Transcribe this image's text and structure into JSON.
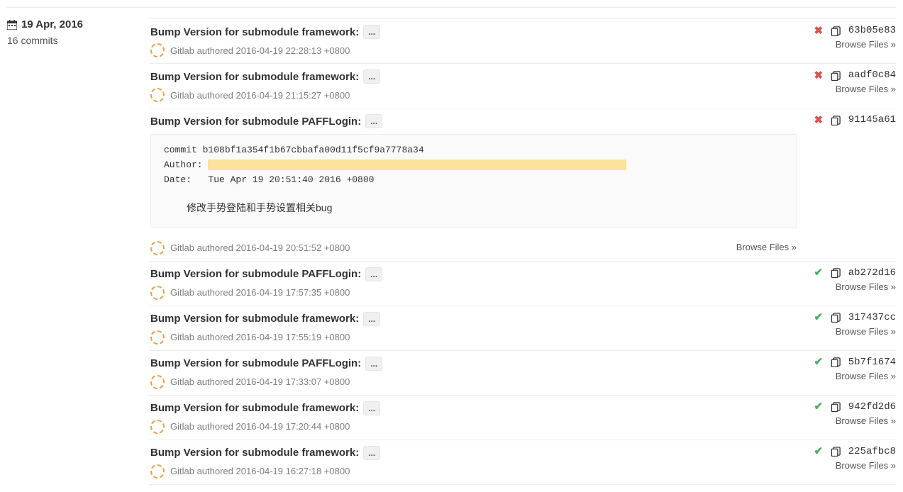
{
  "date": "19 Apr, 2016",
  "commit_count": "16 commits",
  "browse_label": "Browse Files »",
  "commits": [
    {
      "title": "Bump Version for submodule framework:",
      "author": "Gitlab",
      "time": "2016-04-19 22:28:13 +0800",
      "status": "failed",
      "sha": "63b05e83"
    },
    {
      "title": "Bump Version for submodule framework:",
      "author": "Gitlab",
      "time": "2016-04-19 21:15:27 +0800",
      "status": "failed",
      "sha": "aadf0c84"
    },
    {
      "title": "Bump Version for submodule PAFFLogin:",
      "author": "Gitlab",
      "time": "2016-04-19 20:51:52 +0800",
      "status": "failed",
      "sha": "91145a61",
      "expanded": {
        "line1": "commit b108bf1a354f1b67cbbafa00d11f5cf9a7778a34",
        "line2": "Author:",
        "line3": "Date:   Tue Apr 19 20:51:40 2016 +0800",
        "msg": "修改手势登陆和手势设置相关bug"
      }
    },
    {
      "title": "Bump Version for submodule PAFFLogin:",
      "author": "Gitlab",
      "time": "2016-04-19 17:57:35 +0800",
      "status": "success",
      "sha": "ab272d16"
    },
    {
      "title": "Bump Version for submodule framework:",
      "author": "Gitlab",
      "time": "2016-04-19 17:55:19 +0800",
      "status": "success",
      "sha": "317437cc"
    },
    {
      "title": "Bump Version for submodule PAFFLogin:",
      "author": "Gitlab",
      "time": "2016-04-19 17:33:07 +0800",
      "status": "success",
      "sha": "5b7f1674"
    },
    {
      "title": "Bump Version for submodule framework:",
      "author": "Gitlab",
      "time": "2016-04-19 17:20:44 +0800",
      "status": "success",
      "sha": "942fd2d6"
    },
    {
      "title": "Bump Version for submodule framework:",
      "author": "Gitlab",
      "time": "2016-04-19 16:27:18 +0800",
      "status": "success",
      "sha": "225afbc8"
    }
  ]
}
